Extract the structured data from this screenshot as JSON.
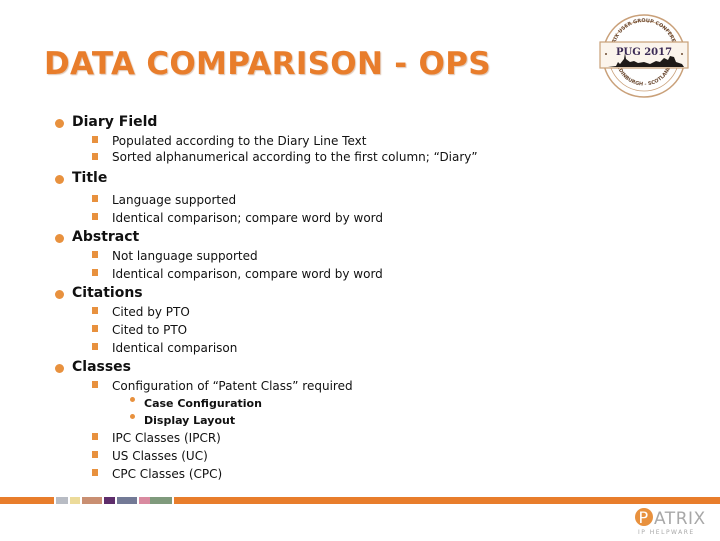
{
  "slide": {
    "title": "DATA COMPARISON - OPS",
    "accent_color": "#e87d2b",
    "sections": [
      {
        "heading": "Diary Field",
        "items": [
          {
            "text": "Populated according to the Diary Line Text"
          },
          {
            "text": "Sorted alphanumerical according to the first column; “Diary”"
          }
        ]
      },
      {
        "heading": "Title",
        "items": [
          {
            "text": "Language supported"
          },
          {
            "text": "Identical comparison; compare word by word"
          }
        ]
      },
      {
        "heading": "Abstract",
        "items": [
          {
            "text": "Not language supported"
          },
          {
            "text": "Identical comparison, compare word by word"
          }
        ]
      },
      {
        "heading": "Citations",
        "items": [
          {
            "text": "Cited by PTO"
          },
          {
            "text": "Cited to PTO"
          },
          {
            "text": "Identical comparison"
          }
        ]
      },
      {
        "heading": "Classes",
        "items": [
          {
            "text": "Configuration of “Patent Class” required",
            "subitems": [
              "Case Configuration",
              "Display Layout"
            ]
          },
          {
            "text": "IPC Classes (IPCR)"
          },
          {
            "text": "US Classes (UC)"
          },
          {
            "text": "CPC Classes (CPC)"
          }
        ]
      }
    ]
  },
  "badge": {
    "icon": "pug-2017-badge-icon",
    "label": "PUG 2017",
    "top_arc_text": "PATRIX USER GROUP CONFERENCE",
    "bottom_arc_text": "EDINBURGH - SCOTLAND"
  },
  "footer": {
    "swatches": [
      "#e87d2b",
      "#b8bcc4",
      "#ecdb9a",
      "#c98f72",
      "#5e2d6b",
      "#737a96",
      "#d98aa0",
      "#7f9a7c",
      "#e87d2b"
    ],
    "brand_name": "PATRIX",
    "brand_tagline": "IP HELPWARE",
    "brand_icon": "patrix-logo-icon"
  }
}
